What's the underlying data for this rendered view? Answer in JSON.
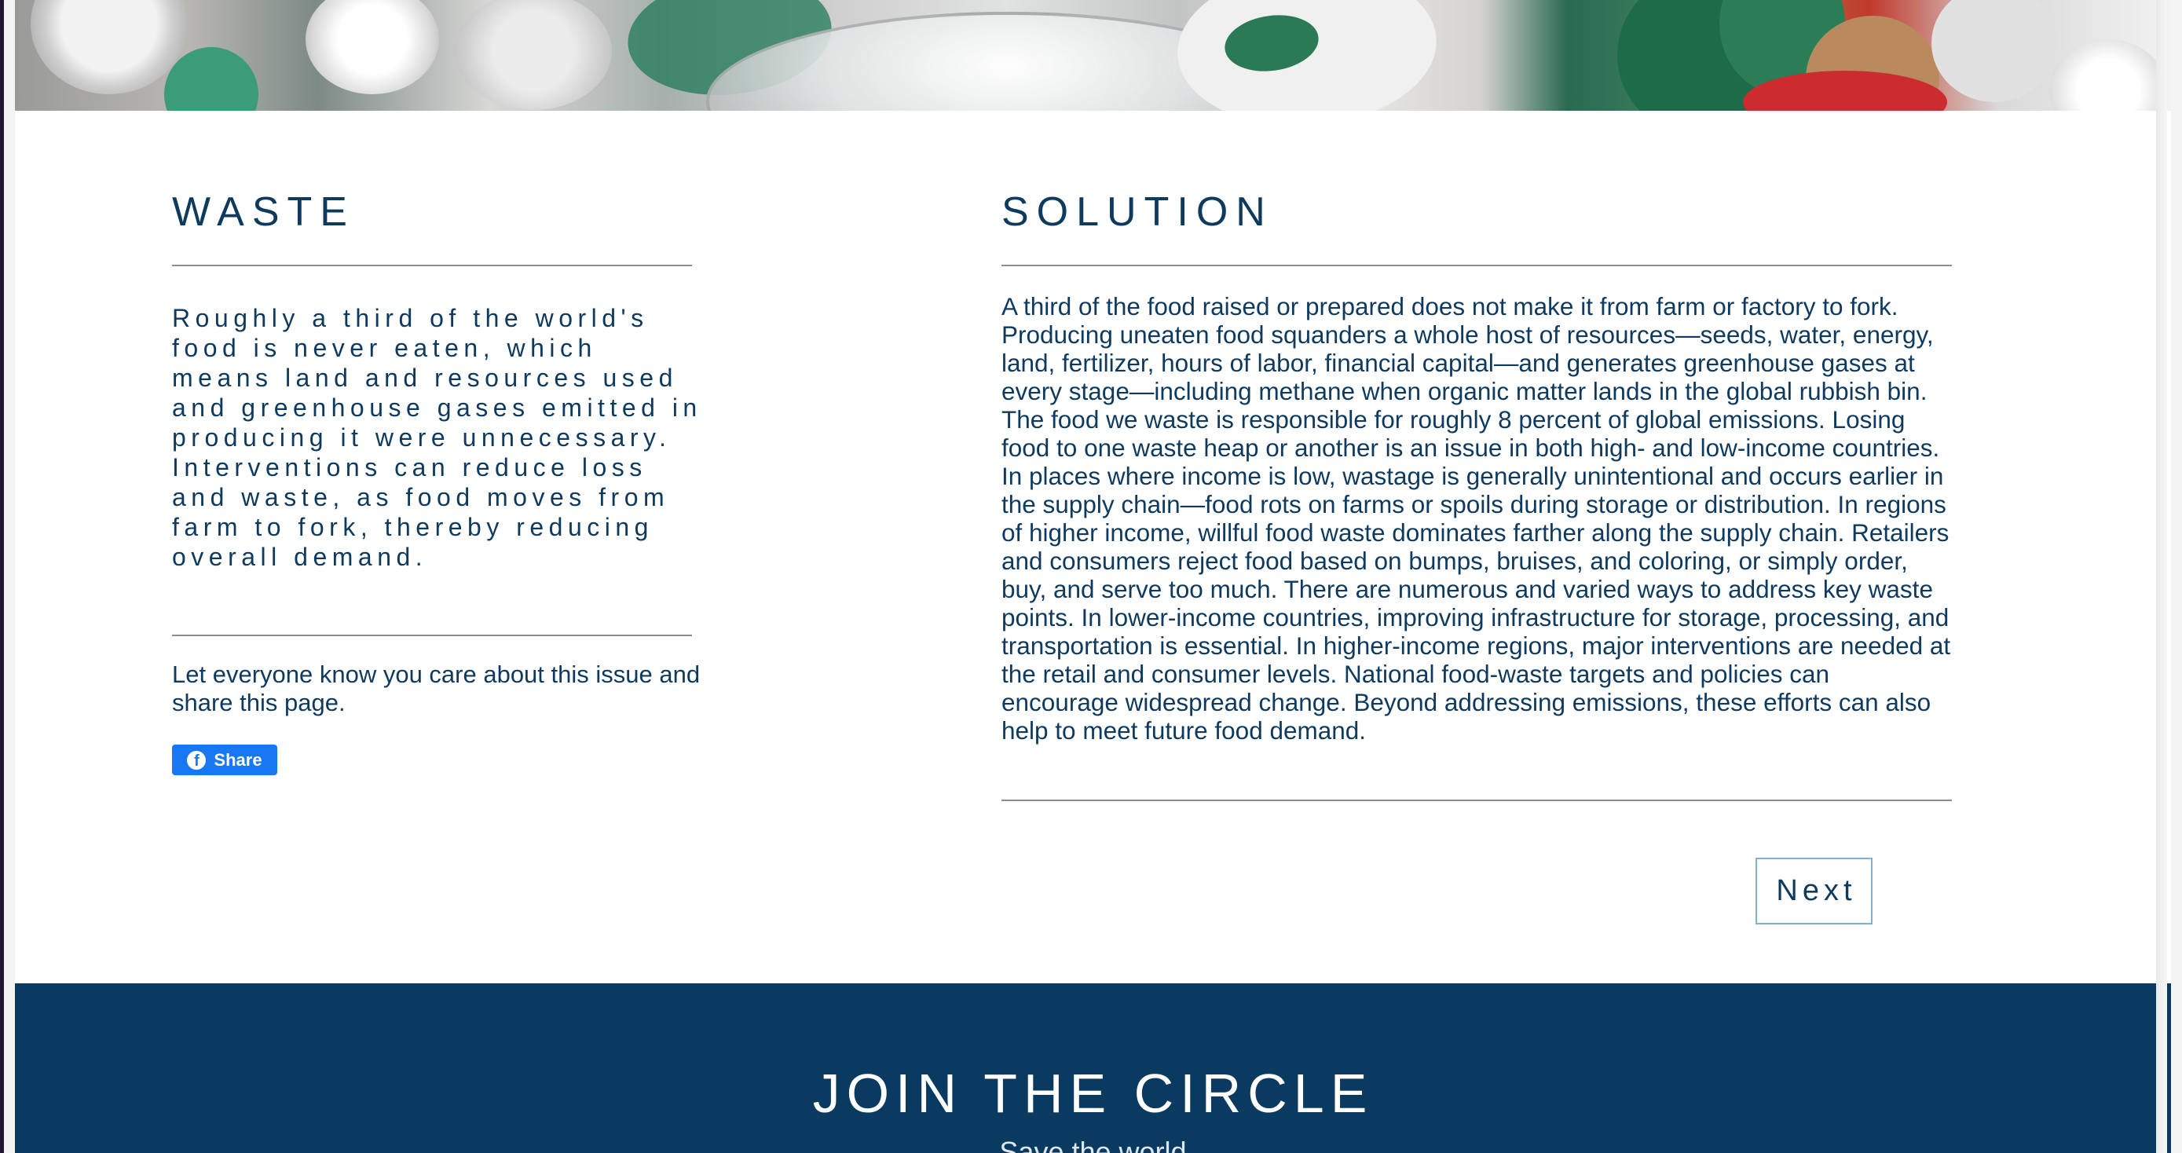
{
  "waste": {
    "heading": "WASTE",
    "summary": "Roughly a third of the world's food is never eaten, which means land and resources used and greenhouse gases emitted in producing it were unnecessary. Interventions can reduce loss and waste, as food moves from farm to fork, thereby reducing overall demand.",
    "share_prompt": "Let everyone know you care about this issue and share this page.",
    "share_button_label": "Share",
    "share_icon": "facebook-icon"
  },
  "solution": {
    "heading": "SOLUTION",
    "text": "A third of the food raised or prepared does not make it from farm or factory to fork. Producing uneaten food squanders a whole host of resources—seeds, water, energy, land, fertilizer, hours of labor, financial capital—and generates greenhouse gases at every stage—including methane when organic matter lands in the global rubbish bin. The food we waste is responsible for roughly 8 percent of global emissions. Losing food to one waste heap or another is an issue in both high- and low-income countries. In places where income is low, wastage is generally unintentional and occurs earlier in the supply chain—food rots on farms or spoils during storage or distribution. In regions of higher income, willful food waste dominates farther along the supply chain. Retailers and consumers reject food based on bumps, bruises, and coloring, or simply order, buy, and serve too much. There are numerous and varied ways to address key waste points. In lower-income countries, improving infrastructure for storage, processing, and transportation is essential. In higher-income regions, major interventions are needed at the retail and consumer levels. National food-waste targets and policies can encourage widespread change. Beyond addressing emissions, these efforts can also help to meet future food demand."
  },
  "navigation": {
    "next_label": "Next"
  },
  "footer": {
    "heading": "JOIN THE CIRCLE",
    "subtitle": "Save the world"
  },
  "colors": {
    "heading_text": "#0e3a5f",
    "footer_background": "#0b3a60",
    "facebook_blue": "#1877f2",
    "next_button_border": "#7fb1d6",
    "rule": "#8c8c8c"
  }
}
